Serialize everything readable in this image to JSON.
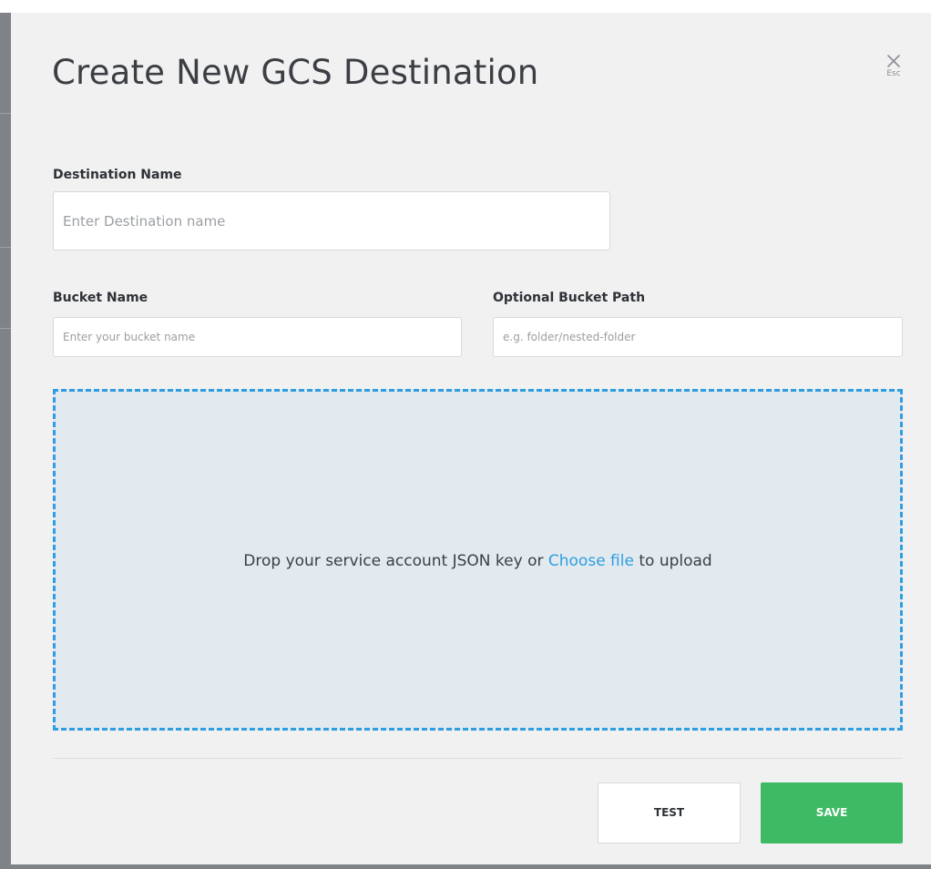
{
  "modal": {
    "title": "Create New GCS Destination",
    "close_hint": "Esc"
  },
  "form": {
    "destination_name": {
      "label": "Destination Name",
      "placeholder": "Enter Destination name",
      "value": ""
    },
    "bucket_name": {
      "label": "Bucket Name",
      "placeholder": "Enter your bucket name",
      "value": ""
    },
    "bucket_path": {
      "label": "Optional Bucket Path",
      "placeholder": "e.g. folder/nested-folder",
      "value": ""
    }
  },
  "dropzone": {
    "text_before": "Drop your service account JSON key or ",
    "link_text": "Choose file",
    "text_after": " to upload"
  },
  "actions": {
    "test_label": "TEST",
    "save_label": "SAVE"
  },
  "colors": {
    "accent": "#2f9ee0",
    "save": "#3dba63",
    "dropzone_bg": "#e2eaf0",
    "modal_bg": "#f1f1f1"
  },
  "icons": {
    "close": "close-icon"
  }
}
